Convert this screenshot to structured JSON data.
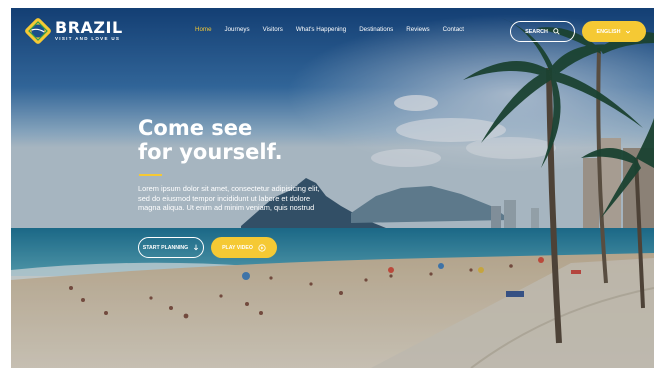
{
  "brand": {
    "name": "BRAZIL",
    "tagline": "VISIT AND LOVE US"
  },
  "nav": {
    "items": [
      {
        "label": "Home",
        "active": true
      },
      {
        "label": "Journeys",
        "active": false
      },
      {
        "label": "Visitors",
        "active": false
      },
      {
        "label": "What's Happening",
        "active": false
      },
      {
        "label": "Destinations",
        "active": false
      },
      {
        "label": "Reviews",
        "active": false
      },
      {
        "label": "Contact",
        "active": false
      }
    ]
  },
  "header": {
    "search_label": "SEARCH",
    "search_icon": "search-icon",
    "language_label": "ENGLISH",
    "language_icon": "chevron-down-icon"
  },
  "hero": {
    "title_line1": "Come see",
    "title_line2": "for yourself.",
    "body": "Lorem ipsum dolor sit amet, consectetur adipisicing elit, sed do eiusmod tempor incididunt ut labore et dolore magna aliqua. Ut enim ad minim veniam, quis nostrud",
    "plan_label": "START PLANNING",
    "plan_icon": "arrow-down-icon",
    "video_label": "PLAY VIDEO",
    "video_icon": "play-icon"
  },
  "colors": {
    "accent": "#f5c934",
    "active_nav": "#f5c934",
    "text": "#ffffff"
  }
}
